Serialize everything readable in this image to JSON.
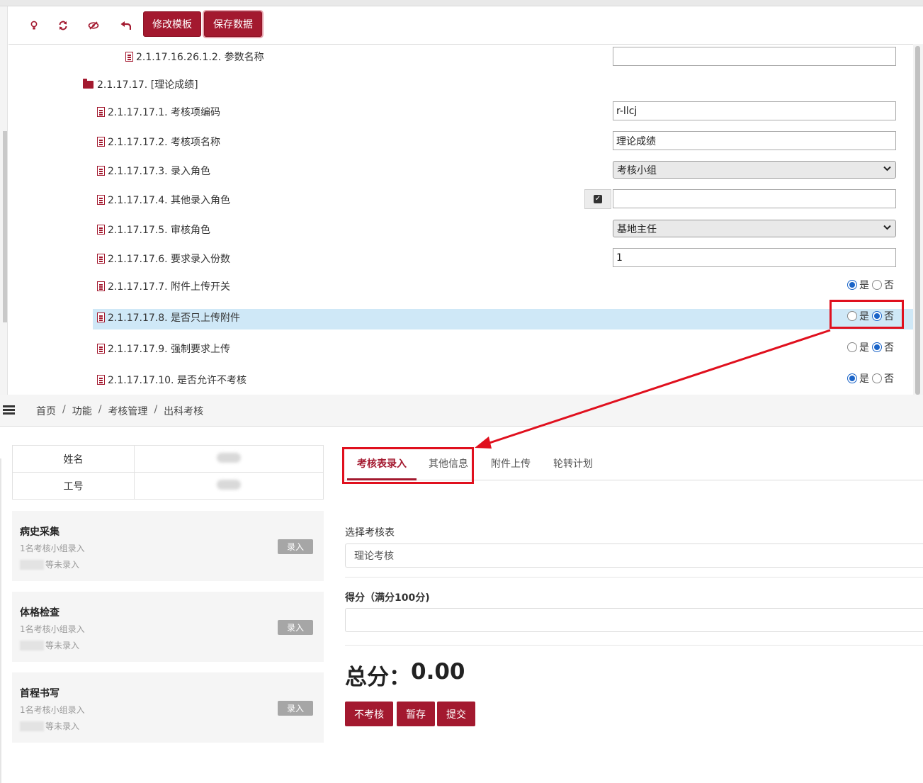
{
  "toolbar": {
    "edit_template": "修改模板",
    "save_data": "保存数据"
  },
  "tree": {
    "row_param": "2.1.17.16.26.1.2. 参数名称",
    "folder": "2.1.17.17. [理论成绩]",
    "r1": "2.1.17.17.1. 考核项编码",
    "r2": "2.1.17.17.2. 考核项名称",
    "r3": "2.1.17.17.3. 录入角色",
    "r4": "2.1.17.17.4. 其他录入角色",
    "r5": "2.1.17.17.5. 审核角色",
    "r6": "2.1.17.17.6. 要求录入份数",
    "r7": "2.1.17.17.7. 附件上传开关",
    "r8": "2.1.17.17.8. 是否只上传附件",
    "r9": "2.1.17.17.9. 强制要求上传",
    "r10": "2.1.17.17.10. 是否允许不考核"
  },
  "values": {
    "param": "",
    "code": "r-llcj",
    "name": "理论成绩",
    "entry_role": "考核小组",
    "other_role": "",
    "review_role": "基地主任",
    "copies": "1"
  },
  "radio": {
    "yes": "是",
    "no": "否",
    "r7": "是",
    "r8": "否",
    "r9": "否",
    "r10": "是"
  },
  "breadcrumb": [
    "首页",
    "功能",
    "考核管理",
    "出科考核"
  ],
  "info": {
    "name_label": "姓名",
    "id_label": "工号"
  },
  "cards": [
    {
      "title": "病史采集",
      "line1": "1名考核小组录入",
      "line2": "等未录入",
      "button": "录入"
    },
    {
      "title": "体格检查",
      "line1": "1名考核小组录入",
      "line2": "等未录入",
      "button": "录入"
    },
    {
      "title": "首程书写",
      "line1": "1名考核小组录入",
      "line2": "等未录入",
      "button": "录入"
    }
  ],
  "tabs": [
    "考核表录入",
    "其他信息",
    "附件上传",
    "轮转计划"
  ],
  "form": {
    "choose_label": "选择考核表",
    "choose_value": "理论考核",
    "score_label": "得分（满分100分)",
    "total_label": "总分：",
    "total_value": "0.00"
  },
  "actions": [
    "不考核",
    "暂存",
    "提交"
  ],
  "colors": {
    "brand": "#a3192f",
    "highlight": "#cfe8f7",
    "annotation": "#e0101e"
  }
}
